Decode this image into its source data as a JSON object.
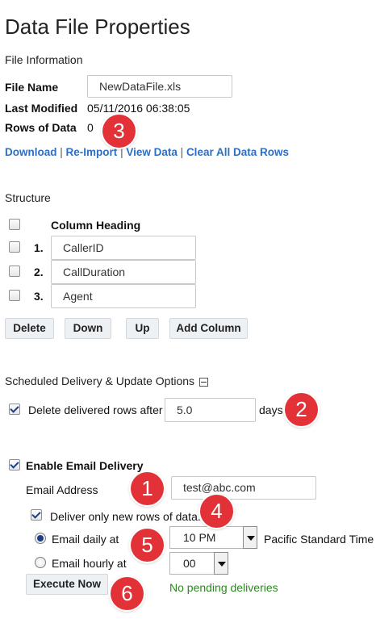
{
  "page_title": "Data File Properties",
  "file_info": {
    "heading": "File Information",
    "file_name_label": "File Name",
    "file_name_value": "NewDataFile.xls",
    "last_modified_label": "Last Modified",
    "last_modified_value": "05/11/2016 06:38:05",
    "rows_label": "Rows of Data",
    "rows_value": "0"
  },
  "links": {
    "download": "Download",
    "reimport": "Re-Import",
    "view_data": "View Data",
    "clear_rows": "Clear All Data Rows",
    "separator": "|"
  },
  "structure": {
    "heading": "Structure",
    "column_heading_label": "Column Heading",
    "rows": [
      {
        "num": "1.",
        "value": "CallerID"
      },
      {
        "num": "2.",
        "value": "CallDuration"
      },
      {
        "num": "3.",
        "value": "Agent"
      }
    ],
    "buttons": {
      "delete": "Delete",
      "down": "Down",
      "up": "Up",
      "add_column": "Add Column"
    }
  },
  "delivery": {
    "heading": "Scheduled Delivery & Update Options",
    "delete_rows_label": "Delete delivered rows after",
    "delete_rows_checked": true,
    "days_value": "5.0",
    "days_suffix": "days."
  },
  "email": {
    "enable_label": "Enable Email Delivery",
    "enable_checked": true,
    "address_label": "Email Address",
    "address_value": "test@abc.com",
    "new_rows_label": "Deliver only new rows of data.",
    "new_rows_checked": true,
    "daily_label": "Email daily at",
    "daily_selected": true,
    "daily_time": "10 PM",
    "timezone": "Pacific Standard Time",
    "hourly_label": "Email hourly at",
    "hourly_minute": "00",
    "execute_label": "Execute Now",
    "status_text": "No pending deliveries"
  },
  "callouts": [
    "1",
    "2",
    "3",
    "4",
    "5",
    "6"
  ],
  "colors": {
    "link": "#2c6fc5",
    "callout": "#e23238",
    "status_ok": "#2a8a1e"
  }
}
